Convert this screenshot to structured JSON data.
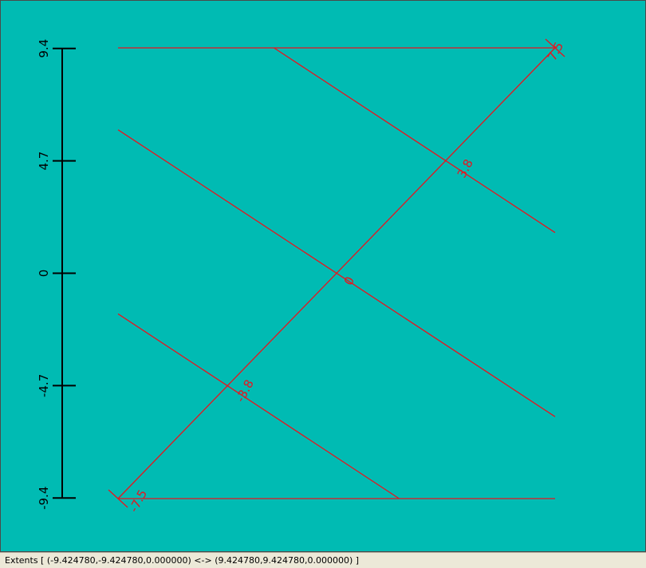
{
  "colors": {
    "background": "#00bbb3",
    "axis": "#000000",
    "series": "#e8141e",
    "statusbar": "#ece9d8"
  },
  "axis": {
    "ticks": [
      {
        "value": 9.4,
        "label": "9.4"
      },
      {
        "value": 4.7,
        "label": "4.7"
      },
      {
        "value": 0,
        "label": "0"
      },
      {
        "value": -4.7,
        "label": "-4.7"
      },
      {
        "value": -9.4,
        "label": "-9.4"
      }
    ]
  },
  "chart_data": {
    "type": "line",
    "x_range": [
      -9.42478,
      9.42478
    ],
    "y_range": [
      -9.42478,
      9.42478
    ],
    "axis_ticks": [
      -9.4,
      -4.7,
      0,
      4.7,
      9.4
    ],
    "lines": [
      {
        "points": [
          [
            -9.42478,
            9.42478
          ],
          [
            9.42478,
            9.42478
          ]
        ]
      },
      {
        "points": [
          [
            -9.42478,
            -9.42478
          ],
          [
            9.42478,
            -9.42478
          ]
        ]
      },
      {
        "points": [
          [
            -9.42478,
            -9.42478
          ],
          [
            9.42478,
            9.42478
          ]
        ]
      },
      {
        "points": [
          [
            -2.7,
            9.42478
          ],
          [
            9.42478,
            1.7
          ]
        ]
      },
      {
        "points": [
          [
            -9.42478,
            6.0
          ],
          [
            9.42478,
            -6.0
          ]
        ]
      },
      {
        "points": [
          [
            -9.42478,
            -1.7
          ],
          [
            2.7,
            -9.42478
          ]
        ]
      }
    ],
    "value_labels": [
      {
        "text": "7.5",
        "x": 9.6,
        "y": 9.2
      },
      {
        "text": "3.8",
        "x": 5.7,
        "y": 4.3
      },
      {
        "text": "0",
        "x": 0.7,
        "y": -0.4
      },
      {
        "text": "-3.8",
        "x": -3.8,
        "y": -5.0
      },
      {
        "text": "-7.5",
        "x": -8.4,
        "y": -9.6
      }
    ]
  },
  "statusbar": {
    "text": "Extents [ (-9.424780,-9.424780,0.000000) <-> (9.424780,9.424780,0.000000) ]"
  }
}
